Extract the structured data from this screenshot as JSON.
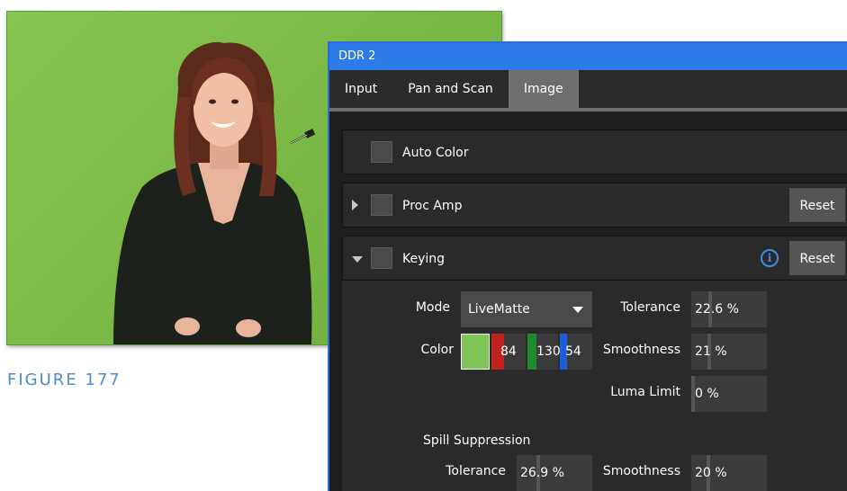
{
  "figure": {
    "caption": "FIGURE 177"
  },
  "panel": {
    "title": "DDR 2",
    "tabs": [
      {
        "label": "Input",
        "active": false
      },
      {
        "label": "Pan and Scan",
        "active": false
      },
      {
        "label": "Image",
        "active": true
      }
    ]
  },
  "sections": {
    "auto_color": {
      "label": "Auto Color",
      "checked": false
    },
    "proc_amp": {
      "label": "Proc Amp",
      "checked": false,
      "expanded": false,
      "reset_label": "Reset"
    },
    "keying": {
      "label": "Keying",
      "checked": false,
      "expanded": true,
      "reset_label": "Reset",
      "info_icon": "i"
    }
  },
  "keying": {
    "mode_label": "Mode",
    "mode_value": "LiveMatte",
    "color_label": "Color",
    "color_swatch": "#7fc657",
    "color_r": "84",
    "color_g": "130",
    "color_b": "54",
    "tolerance_label": "Tolerance",
    "tolerance_value": "22.6 %",
    "smoothness_label": "Smoothness",
    "smoothness_value": "21 %",
    "luma_limit_label": "Luma Limit",
    "luma_limit_value": "0 %",
    "spill_label": "Spill Suppression",
    "spill_tolerance_label": "Tolerance",
    "spill_tolerance_value": "26.9 %",
    "spill_smoothness_label": "Smoothness",
    "spill_smoothness_value": "20 %"
  },
  "colors": {
    "accent": "#2d7be6",
    "panel_bg": "#1e1e1e",
    "red_channel": "#c0231f",
    "green_channel": "#1f8a2f",
    "blue_channel": "#1c5fd6",
    "key_green": "#7ab845"
  }
}
